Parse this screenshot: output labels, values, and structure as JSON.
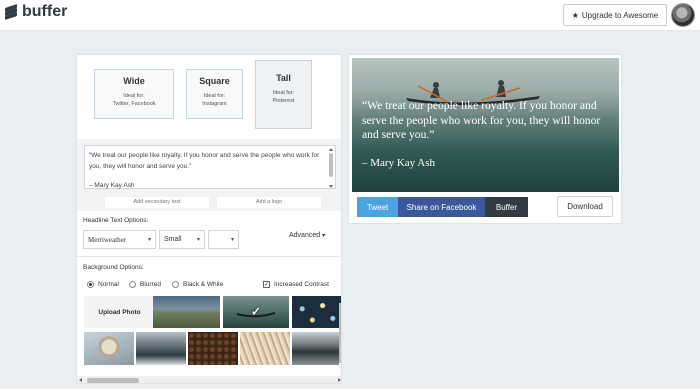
{
  "header": {
    "logo_text": "buffer",
    "upgrade_label": "Upgrade to Awesome"
  },
  "sizes": [
    {
      "title": "Wide",
      "ideal": "Ideal for:",
      "platforms": "Twitter, Facebook"
    },
    {
      "title": "Square",
      "ideal": "Ideal for:",
      "platforms": "Instagram"
    },
    {
      "title": "Tall",
      "ideal": "Ideal for:",
      "platforms": "Pinterest"
    }
  ],
  "editor": {
    "quote": "“We treat our people like royalty. If you honor and serve the people who work for you, they will honor and serve you.”",
    "author": "– Mary Kay Ash",
    "secondary_placeholder": "Add secondary text",
    "logo_placeholder": "Add a logo"
  },
  "headline": {
    "label": "Headline Text Options:",
    "font": "Merriweather",
    "size": "Small",
    "advanced": "Advanced"
  },
  "background": {
    "label": "Background Options:",
    "options": [
      "Normal",
      "Blurred",
      "Black & White"
    ],
    "contrast_label": "Increased Contrast",
    "upload_label": "Upload Photo"
  },
  "preview": {
    "quote": "“We treat our people like royalty. If you honor and serve the people who work for you, they will honor and serve you.”",
    "author": "– Mary Kay Ash"
  },
  "actions": {
    "tweet": "Tweet",
    "facebook": "Share on Facebook",
    "buffer": "Buffer",
    "download": "Download"
  },
  "colors": {
    "tweet": "#4ba3df",
    "facebook": "#3b5998",
    "buffer": "#323b43"
  }
}
